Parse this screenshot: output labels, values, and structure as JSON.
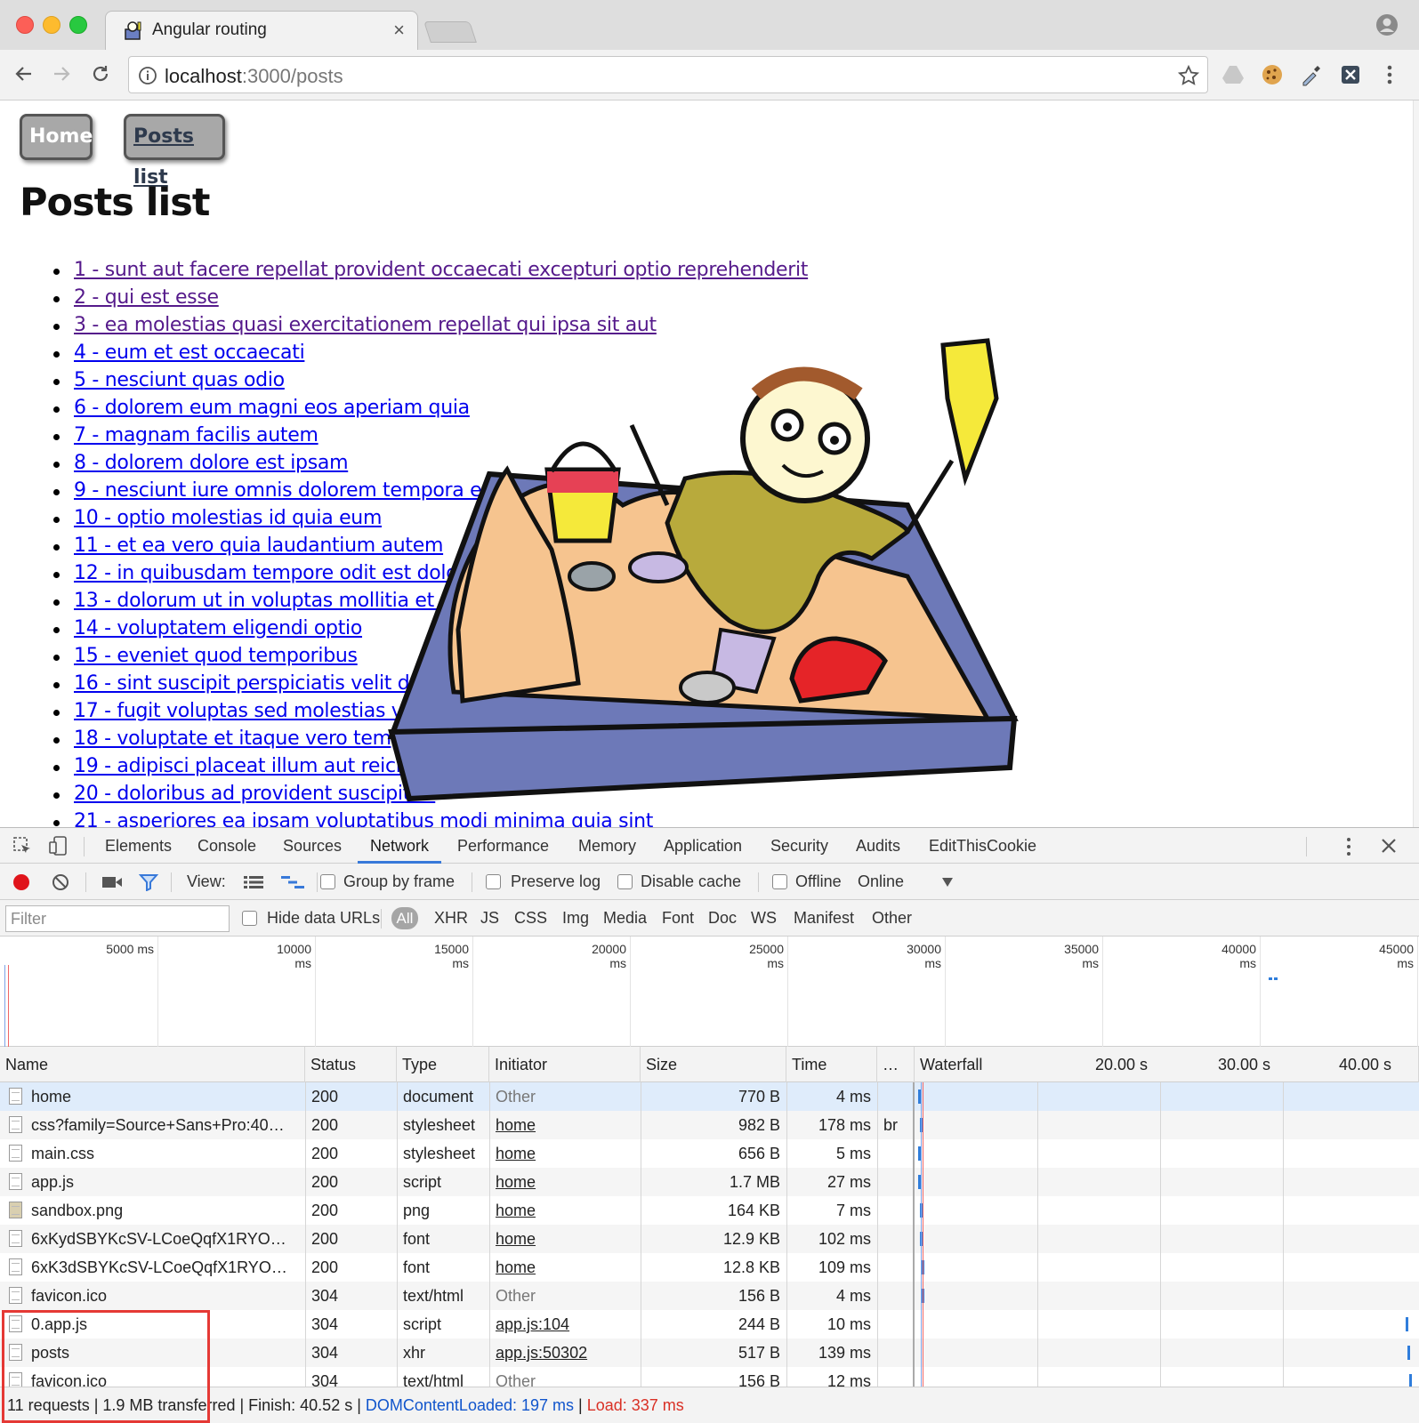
{
  "browser": {
    "tab_title": "Angular routing",
    "tab_close": "×",
    "url_host": "localhost",
    "url_rest": ":3000/posts",
    "icons": [
      "back-arrow-icon",
      "forward-arrow-icon",
      "reload-icon",
      "info-icon",
      "star-icon",
      "drive-icon",
      "cookie-icon",
      "eyedropper-icon",
      "extension-x-icon",
      "more-vertical-icon",
      "profile-icon"
    ]
  },
  "page": {
    "home_button": "Home",
    "posts_button": "Posts list",
    "title": "Posts list",
    "posts": [
      "1 - sunt aut facere repellat provident occaecati excepturi optio reprehenderit",
      "2 - qui est esse",
      "3 - ea molestias quasi exercitationem repellat qui ipsa sit aut",
      "4 - eum et est occaecati",
      "5 - nesciunt quas odio",
      "6 - dolorem eum magni eos aperiam quia",
      "7 - magnam facilis autem",
      "8 - dolorem dolore est ipsam",
      "9 - nesciunt iure omnis dolorem tempora et accusantium",
      "10 - optio molestias id quia eum",
      "11 - et ea vero quia laudantium autem",
      "12 - in quibusdam tempore odit est dolorem",
      "13 - dolorum ut in voluptas mollitia et saepe quo animi",
      "14 - voluptatem eligendi optio",
      "15 - eveniet quod temporibus",
      "16 - sint suscipit perspiciatis velit dolorum rerum ipsa laboriosam odio",
      "17 - fugit voluptas sed molestias voluptatem provident",
      "18 - voluptate et itaque vero tempora molestiae",
      "19 - adipisci placeat illum aut reiciendis qui",
      "20 - doloribus ad provident suscipit at",
      "21 - asperiores ea ipsam voluptatibus modi minima quia sint"
    ],
    "visited_count": 3
  },
  "devtools": {
    "tabs": [
      "Elements",
      "Console",
      "Sources",
      "Network",
      "Performance",
      "Memory",
      "Application",
      "Security",
      "Audits",
      "EditThisCookie"
    ],
    "active_tab": "Network",
    "view_label": "View:",
    "group_by_frame": "Group by frame",
    "preserve_log": "Preserve log",
    "disable_cache": "Disable cache",
    "offline": "Offline",
    "online": "Online",
    "filter_placeholder": "Filter",
    "hide_data_urls": "Hide data URLs",
    "types": [
      "All",
      "XHR",
      "JS",
      "CSS",
      "Img",
      "Media",
      "Font",
      "Doc",
      "WS",
      "Manifest",
      "Other"
    ],
    "overview_ticks": [
      "5000 ms",
      "10000 ms",
      "15000 ms",
      "20000 ms",
      "25000 ms",
      "30000 ms",
      "35000 ms",
      "40000 ms",
      "45000 ms"
    ],
    "columns": [
      "Name",
      "Status",
      "Type",
      "Initiator",
      "Size",
      "Time",
      "…",
      "Waterfall"
    ],
    "waterfall_ticks": [
      "20.00 s",
      "30.00 s",
      "40.00 s"
    ],
    "rows": [
      {
        "name": "home",
        "status": "200",
        "type": "document",
        "initiator": "Other",
        "size": "770 B",
        "time": "4 ms",
        "extra": ""
      },
      {
        "name": "css?family=Source+Sans+Pro:40…",
        "status": "200",
        "type": "stylesheet",
        "initiator": "home",
        "size": "982 B",
        "time": "178 ms",
        "extra": "br"
      },
      {
        "name": "main.css",
        "status": "200",
        "type": "stylesheet",
        "initiator": "home",
        "size": "656 B",
        "time": "5 ms",
        "extra": ""
      },
      {
        "name": "app.js",
        "status": "200",
        "type": "script",
        "initiator": "home",
        "size": "1.7 MB",
        "time": "27 ms",
        "extra": ""
      },
      {
        "name": "sandbox.png",
        "status": "200",
        "type": "png",
        "initiator": "home",
        "size": "164 KB",
        "time": "7 ms",
        "extra": ""
      },
      {
        "name": "6xKydSBYKcSV-LCoeQqfX1RYO…",
        "status": "200",
        "type": "font",
        "initiator": "home",
        "size": "12.9 KB",
        "time": "102 ms",
        "extra": ""
      },
      {
        "name": "6xK3dSBYKcSV-LCoeQqfX1RYO…",
        "status": "200",
        "type": "font",
        "initiator": "home",
        "size": "12.8 KB",
        "time": "109 ms",
        "extra": ""
      },
      {
        "name": "favicon.ico",
        "status": "304",
        "type": "text/html",
        "initiator": "Other",
        "size": "156 B",
        "time": "4 ms",
        "extra": ""
      },
      {
        "name": "0.app.js",
        "status": "304",
        "type": "script",
        "initiator": "app.js:104",
        "size": "244 B",
        "time": "10 ms",
        "extra": ""
      },
      {
        "name": "posts",
        "status": "304",
        "type": "xhr",
        "initiator": "app.js:50302",
        "size": "517 B",
        "time": "139 ms",
        "extra": ""
      },
      {
        "name": "favicon.ico",
        "status": "304",
        "type": "text/html",
        "initiator": "Other",
        "size": "156 B",
        "time": "12 ms",
        "extra": ""
      }
    ],
    "status_bar": {
      "summary": "11 requests | 1.9 MB transferred | Finish: 40.52 s | ",
      "dom_content_loaded": "DOMContentLoaded: 197 ms",
      "separator": " | ",
      "load": "Load: 337 ms"
    }
  }
}
